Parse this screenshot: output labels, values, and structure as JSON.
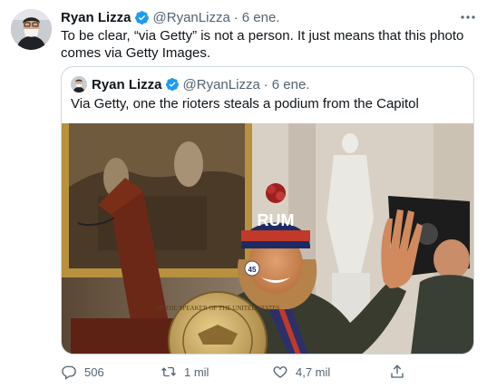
{
  "tweet": {
    "author_name": "Ryan Lizza",
    "handle": "@RyanLizza",
    "separator": "·",
    "time": "6 ene.",
    "text": "To be clear, “via Getty” is not a person. It just means that this photo comes via Getty Images."
  },
  "quoted": {
    "author_name": "Ryan Lizza",
    "handle": "@RyanLizza",
    "separator": "·",
    "time": "6 ene.",
    "text": "Via Getty, one the rioters steals a podium from the Capitol",
    "photo": {
      "hat_text": "RUM",
      "pin_text": "45",
      "seal_text": "OF THE SPEAKER OF THE UNITED STATES"
    }
  },
  "actions": {
    "reply_count": "506",
    "retweet_count": "1 mil",
    "like_count": "4,7 mil"
  },
  "icons": [
    "more-icon",
    "verified-icon",
    "reply-icon",
    "retweet-icon",
    "like-icon",
    "share-icon"
  ],
  "colors": {
    "verified_blue": "#1d9bf0",
    "secondary_text": "#536471",
    "border": "#cfd9de"
  }
}
